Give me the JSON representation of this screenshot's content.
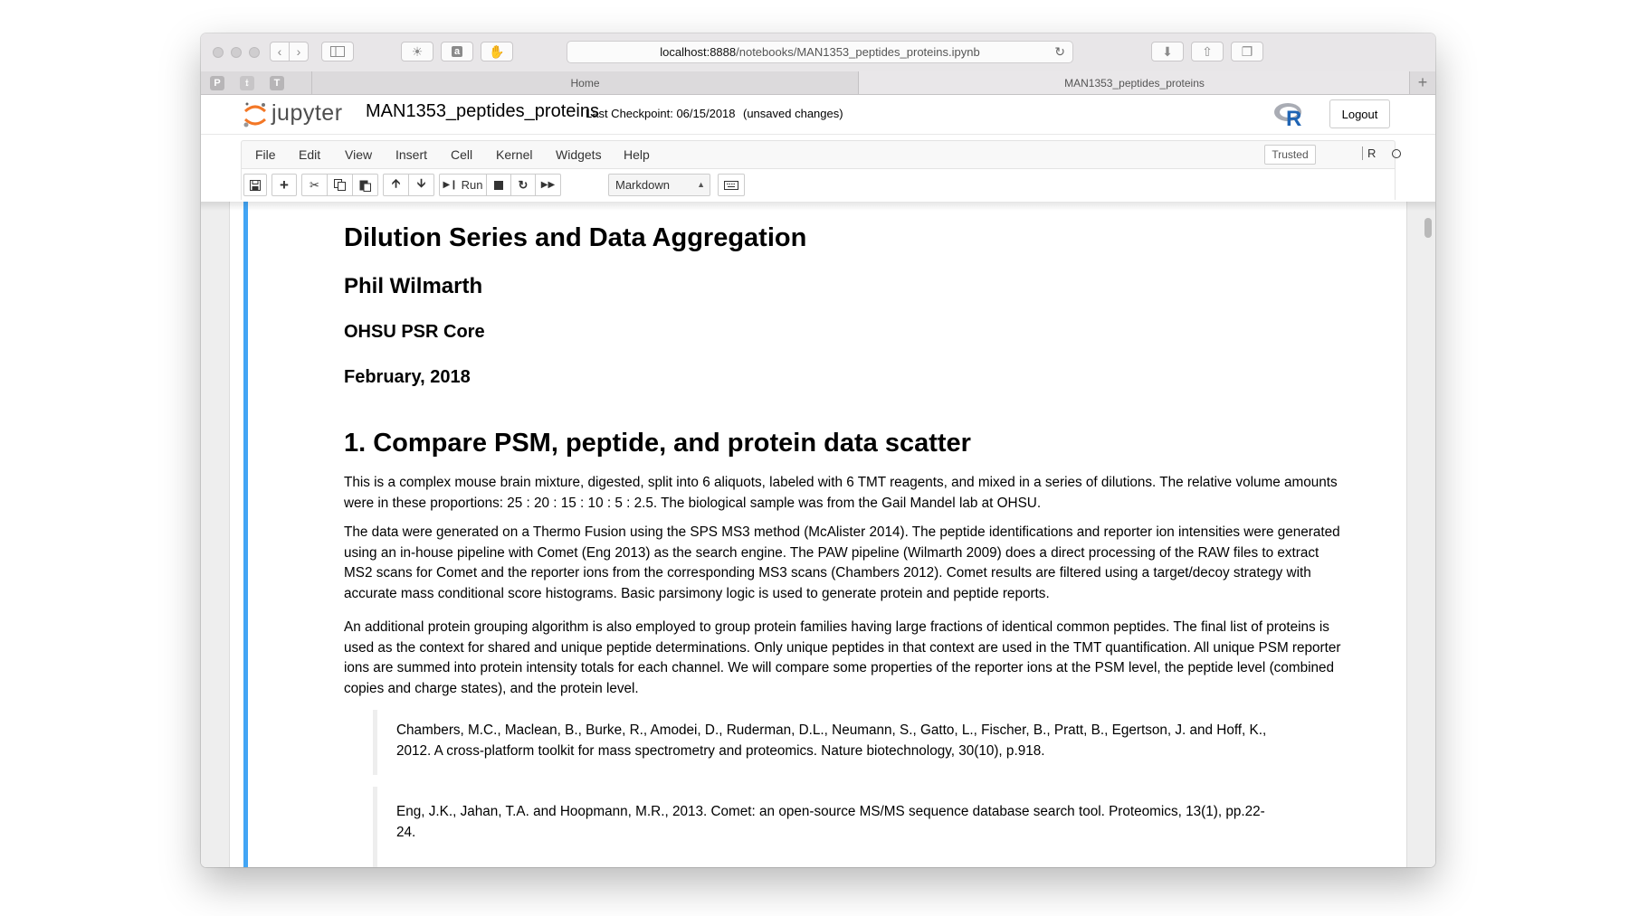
{
  "browser": {
    "url_host": "localhost:8888",
    "url_path": "/notebooks/MAN1353_peptides_proteins.ipynb",
    "favorites": [
      "P",
      "T"
    ],
    "tabs": [
      {
        "label": "Home"
      },
      {
        "label": "MAN1353_peptides_proteins"
      }
    ]
  },
  "header": {
    "logo_text": "jupyter",
    "notebook_name": "MAN1353_peptides_proteins",
    "checkpoint": "Last Checkpoint: 06/15/2018",
    "unsaved": "(unsaved changes)",
    "logout_label": "Logout"
  },
  "menubar": {
    "items": [
      "File",
      "Edit",
      "View",
      "Insert",
      "Cell",
      "Kernel",
      "Widgets",
      "Help"
    ],
    "trusted_label": "Trusted",
    "kernel_name": "R"
  },
  "toolbar": {
    "run_label": "Run",
    "cell_type": "Markdown"
  },
  "notebook": {
    "title": "Dilution Series and Data Aggregation",
    "author": "Phil Wilmarth",
    "organization": "OHSU PSR Core",
    "date": "February, 2018",
    "section_heading": "1. Compare PSM, peptide, and protein data scatter",
    "paragraphs": [
      "This is a complex mouse brain mixture, digested, split into 6 aliquots, labeled with 6 TMT reagents, and mixed in a series of dilutions. The relative volume amounts were in these proportions: 25 : 20 : 15 : 10 : 5 : 2.5. The biological sample was from the Gail Mandel lab at OHSU.",
      "The data were generated on a Thermo Fusion using the SPS MS3 method (McAlister 2014). The peptide identifications and reporter ion intensities were generated using an in-house pipeline with Comet (Eng 2013) as the search engine. The PAW pipeline (Wilmarth 2009) does a direct processing of the RAW files to extract MS2 scans for Comet and the reporter ions from the corresponding MS3 scans (Chambers 2012). Comet results are filtered using a target/decoy strategy with accurate mass conditional score histograms. Basic parsimony logic is used to generate protein and peptide reports.",
      "An additional protein grouping algorithm is also employed to group protein families having large fractions of identical common peptides. The final list of proteins is used as the context for shared and unique peptide determinations. Only unique peptides in that context are used in the TMT quantification. All unique PSM reporter ions are summed into protein intensity totals for each channel. We will compare some properties of the reporter ions at the PSM level, the peptide level (combined copies and charge states), and the protein level."
    ],
    "references": [
      "Chambers, M.C., Maclean, B., Burke, R., Amodei, D., Ruderman, D.L., Neumann, S., Gatto, L., Fischer, B., Pratt, B., Egertson, J. and Hoff, K., 2012. A cross-platform toolkit for mass spectrometry and proteomics. Nature biotechnology, 30(10), p.918.",
      "Eng, J.K., Jahan, T.A. and Hoopmann, M.R., 2013. Comet: an open-source MS/MS sequence database search tool. Proteomics, 13(1), pp.22-24."
    ]
  },
  "colors": {
    "cell_selected_bar": "#42a5f5",
    "jupyter_orange": "#f37726"
  }
}
